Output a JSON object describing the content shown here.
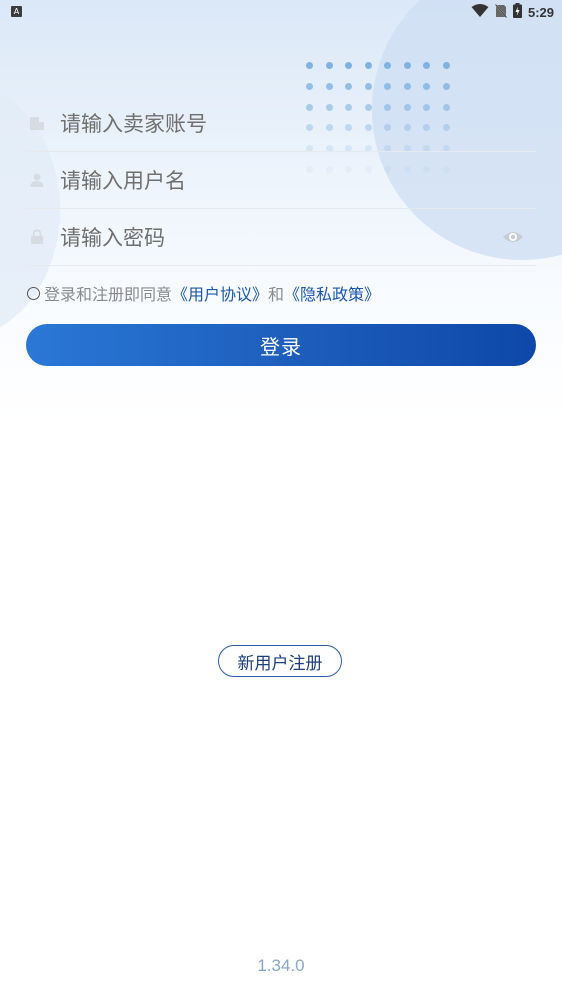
{
  "status_bar": {
    "badge": "A",
    "time": "5:29",
    "icons": [
      "wifi-icon",
      "no-sim-icon",
      "battery-charging-icon"
    ]
  },
  "form": {
    "seller_account_placeholder": "请输入卖家账号",
    "username_placeholder": "请输入用户名",
    "password_placeholder": "请输入密码",
    "icons": {
      "seller_account": "building-icon",
      "username": "person-icon",
      "password": "lock-icon",
      "toggle_password": "eye-icon"
    }
  },
  "agreement": {
    "prefix": "登录和注册即同意",
    "user_agreement": "《用户协议》",
    "joiner": "和",
    "privacy_policy": "《隐私政策》"
  },
  "login_button": "登录",
  "register_button": "新用户注册",
  "version": "1.34.0",
  "colors": {
    "primary": "#1b5ab8",
    "link": "#1a57b0",
    "placeholder": "#6f6f6f",
    "version": "#8aa6c8"
  }
}
